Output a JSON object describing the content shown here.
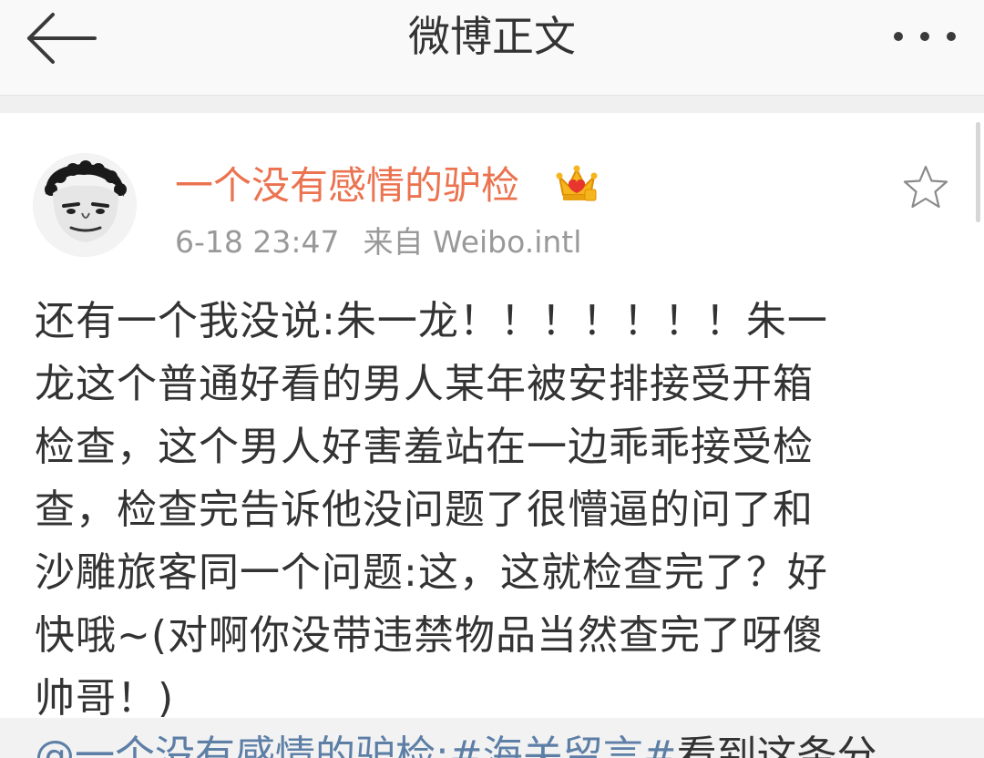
{
  "header": {
    "title": "微博正文"
  },
  "post": {
    "username": "一个没有感情的驴检",
    "time": "6-18 23:47",
    "source_prefix": "来自",
    "source": "Weibo.intl",
    "text": "还有一个我没说:朱一龙！！！！！！！朱一\n龙这个普通好看的男人某年被安排接受开箱\n检查，这个男人好害羞站在一边乖乖接受检\n查，检查完告诉他没问题了很懵逼的问了和\n沙雕旅客同一个问题:这，这就检查完了？好\n快哦~(对啊你没带违禁物品当然查完了呀傻\n帅哥！)"
  },
  "repost": {
    "mention": "@一个没有感情的驴检:",
    "hashtag": "#海关留言#",
    "text": "看到这条分"
  },
  "icons": {
    "back": "back-arrow-icon",
    "more": "more-dots-icon",
    "crown": "vip-crown-icon",
    "star": "favorite-star-icon"
  },
  "colors": {
    "username": "#eb7350",
    "link": "#5d7fa6",
    "meta": "#999999",
    "text": "#333333"
  }
}
